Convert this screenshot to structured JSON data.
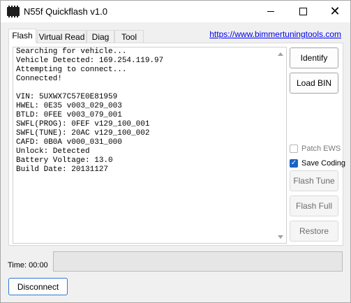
{
  "window": {
    "title": "N55f Quickflash v1.0"
  },
  "tabs": [
    {
      "label": "Flash",
      "active": true
    },
    {
      "label": "Virtual Read",
      "active": false
    },
    {
      "label": "Diag",
      "active": false
    },
    {
      "label": "Tool",
      "active": false
    }
  ],
  "link": {
    "text": "https://www.bimmertuningtools.com"
  },
  "console": {
    "lines": [
      "Searching for vehicle...",
      "Vehicle Detected: 169.254.119.97",
      "Attempting to connect...",
      "Connected!",
      "",
      "VIN: 5UXWX7C57E0E81959",
      "HWEL: 0E35 v003_029_003",
      "BTLD: 0FEE v003_079_001",
      "SWFL(PROG): 0FEF v129_100_001",
      "SWFL(TUNE): 20AC v129_100_002",
      "CAFD: 0B0A v000_031_000",
      "Unlock: Detected",
      "Battery Voltage: 13.0",
      "Build Date: 20131127"
    ]
  },
  "buttons": {
    "identify": "Identify",
    "load_bin": "Load BIN",
    "flash_tune": "Flash Tune",
    "flash_full": "Flash Full",
    "restore": "Restore",
    "disconnect": "Disconnect"
  },
  "checkboxes": {
    "patch_ews": {
      "label": "Patch EWS",
      "checked": false
    },
    "save_coding": {
      "label": "Save Coding",
      "checked": true
    }
  },
  "status": {
    "time": "Time: 00:00",
    "progress": 0
  },
  "icons": {
    "app": "chip-icon",
    "minimize": "minimize-icon",
    "maximize": "maximize-icon",
    "close": "close-icon",
    "scroll_up": "scroll-up-arrow-icon",
    "scroll_down": "scroll-down-arrow-icon",
    "check": "checkmark-icon"
  },
  "colors": {
    "accent": "#1a64c4",
    "link": "#0000ee"
  }
}
